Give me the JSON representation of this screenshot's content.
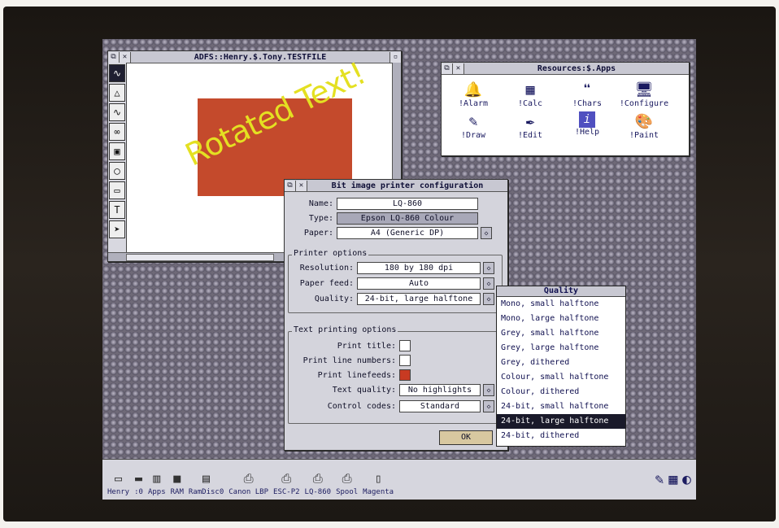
{
  "draw_window": {
    "title": "ADFS::Henry.$.Tony.TESTFILE",
    "rotated_text": "Rotated Text!",
    "tools": [
      "∿",
      "△",
      "∿",
      "∞",
      "▣",
      "◯",
      "▭",
      "T",
      "➤"
    ]
  },
  "resources_window": {
    "title": "Resources:$.Apps",
    "apps": [
      {
        "label": "!Alarm",
        "icon": "🔔"
      },
      {
        "label": "!Calc",
        "icon": "▦"
      },
      {
        "label": "!Chars",
        "icon": "❝"
      },
      {
        "label": "!Configure",
        "icon": "🖥"
      },
      {
        "label": "!Draw",
        "icon": "✎"
      },
      {
        "label": "!Edit",
        "icon": "✒"
      },
      {
        "label": "!Help",
        "icon": "i"
      },
      {
        "label": "!Paint",
        "icon": "🎨"
      }
    ]
  },
  "dialog": {
    "title": "Bit image printer configuration",
    "name_label": "Name:",
    "name_value": "LQ-860",
    "type_label": "Type:",
    "type_value": "Epson LQ-860 Colour",
    "paper_label": "Paper:",
    "paper_value": "A4 (Generic DP)",
    "printer_options_title": "Printer options",
    "resolution_label": "Resolution:",
    "resolution_value": "180 by 180 dpi",
    "paper_feed_label": "Paper feed:",
    "paper_feed_value": "Auto",
    "quality_label": "Quality:",
    "quality_value": "24-bit, large halftone",
    "text_options_title": "Text printing options",
    "print_title_label": "Print title:",
    "print_title_on": false,
    "print_line_numbers_label": "Print line numbers:",
    "print_line_numbers_on": false,
    "print_linefeeds_label": "Print linefeeds:",
    "print_linefeeds_on": true,
    "text_quality_label": "Text quality:",
    "text_quality_value": "No highlights",
    "control_codes_label": "Control codes:",
    "control_codes_value": "Standard",
    "ok_label": "OK"
  },
  "quality_menu": {
    "title": "Quality",
    "items": [
      "Mono, small halftone",
      "Mono, large halftone",
      "Grey, small halftone",
      "Grey, large halftone",
      "Grey, dithered",
      "Colour, small halftone",
      "Colour, dithered",
      "24-bit, small halftone",
      "24-bit, large halftone",
      "24-bit, dithered"
    ],
    "selected_index": 8
  },
  "iconbar": {
    "items": [
      {
        "label": "Henry",
        "icon": "▭"
      },
      {
        "label": ":0",
        "icon": "▬"
      },
      {
        "label": "Apps",
        "icon": "▥"
      },
      {
        "label": "RAM",
        "icon": "■"
      },
      {
        "label": "RamDisc0",
        "icon": "▤"
      },
      {
        "label": "Canon LBP",
        "icon": "⎙"
      },
      {
        "label": "ESC-P2",
        "icon": "⎙"
      },
      {
        "label": "LQ-860",
        "icon": "⎙"
      },
      {
        "label": "Spool",
        "icon": "⎙"
      },
      {
        "label": "Magenta",
        "icon": "▯"
      }
    ],
    "right_icons": [
      "✎",
      "▦",
      "◐"
    ]
  }
}
